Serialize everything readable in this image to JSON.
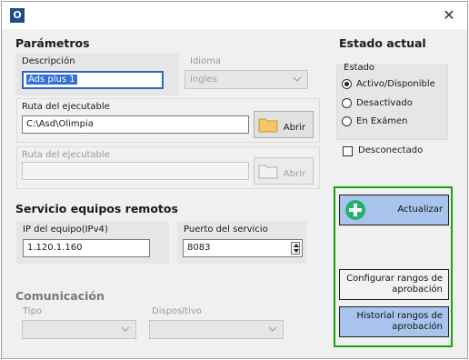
{
  "window": {
    "app_icon_letter": "O",
    "close_glyph": "✕"
  },
  "parametros": {
    "title": "Parámetros",
    "descripcion_label": "Descripción",
    "descripcion_value": "Ads plus 1",
    "idioma_label": "Idioma",
    "idioma_value": "Ingles",
    "ruta1_label": "Ruta del ejecutable",
    "ruta1_value": "C:\\Asd\\Olimpia",
    "ruta1_button": "Abrir",
    "ruta2_label": "Ruta del ejecutable",
    "ruta2_value": "",
    "ruta2_button": "Abrir"
  },
  "servicio": {
    "title": "Servicio equipos remotos",
    "ip_label": "IP del equipo(IPv4)",
    "ip_value": "1.120.1.160",
    "puerto_label": "Puerto del servicio",
    "puerto_value": "8083"
  },
  "comunicacion": {
    "title": "Comunicación",
    "tipo_label": "Tipo",
    "tipo_value": "",
    "dispositivo_label": "Dispositivo",
    "dispositivo_value": ""
  },
  "estado_actual": {
    "title": "Estado actual",
    "estado_label": "Estado",
    "options": [
      "Activo/Disponible",
      "Desactivado",
      "En Exámen"
    ],
    "selected_index": 0,
    "desconectado_label": "Desconectado",
    "desconectado_checked": false
  },
  "actions": {
    "actualizar": "Actualizar",
    "configurar": "Configurar rangos de aprobación",
    "historial": "Historial rangos de aprobación"
  },
  "colors": {
    "accent_blue": "#a8c4ec",
    "frame_green": "#16a30f",
    "plus_green": "#23b26a"
  }
}
